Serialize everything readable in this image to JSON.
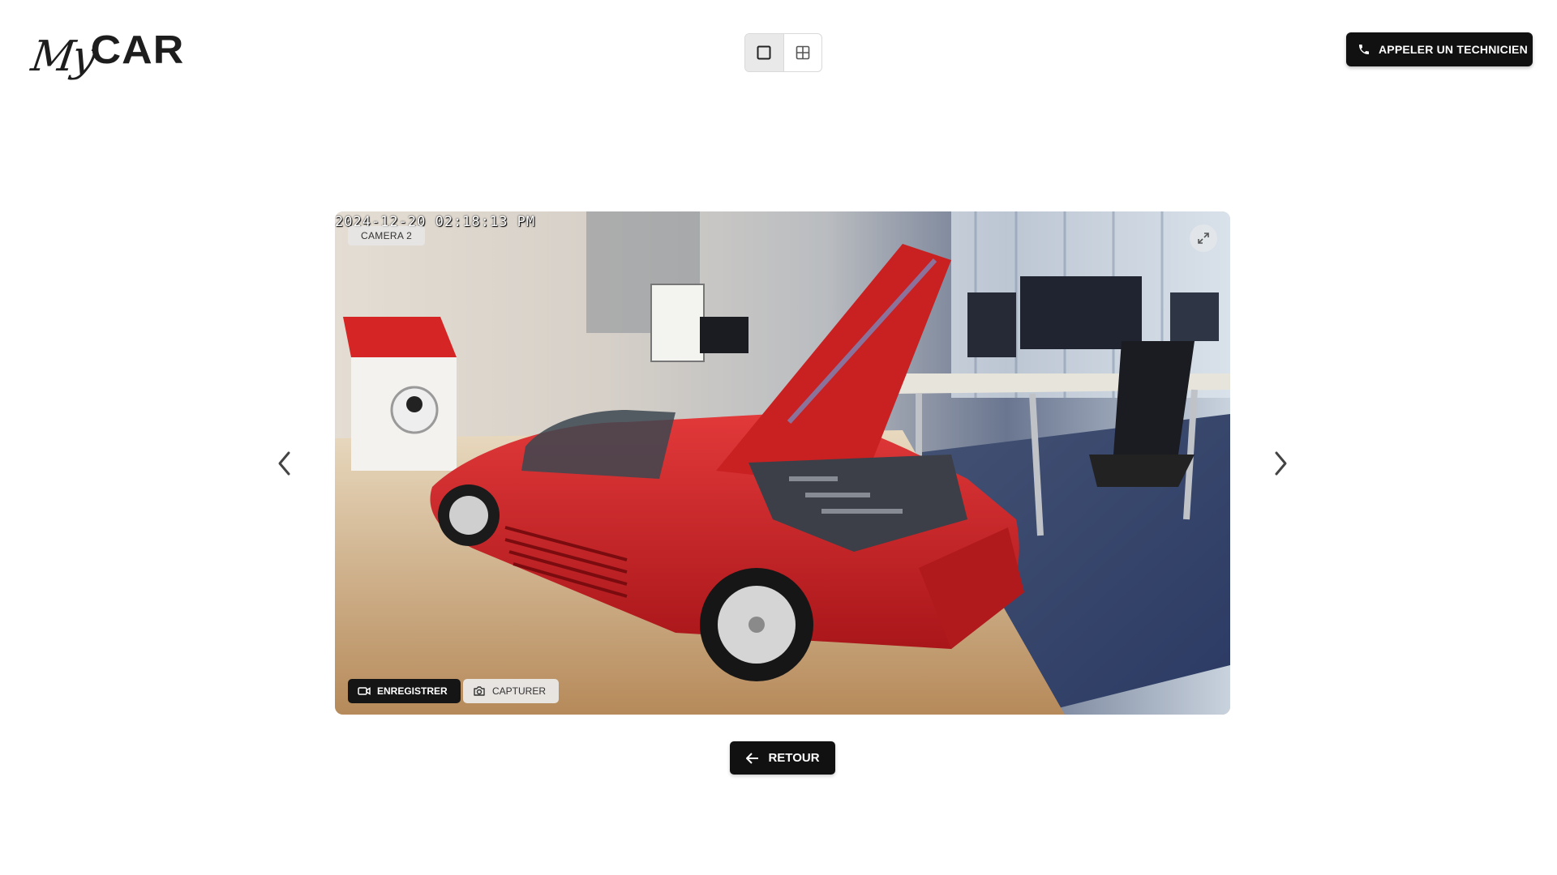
{
  "header": {
    "logo": {
      "script_part": "My",
      "bold_part": "CAR"
    },
    "view_toggle": {
      "options": [
        {
          "icon": "single-view-icon",
          "active": true
        },
        {
          "icon": "grid-view-icon",
          "active": false
        }
      ]
    },
    "call_button": {
      "label": "APPELER UN TECHNICIEN",
      "icon": "phone-icon"
    }
  },
  "viewer": {
    "timestamp": "2024-12-20 02:18:13 PM",
    "camera_label": "CAMERA 2",
    "fullscreen_icon": "expand-icon",
    "record_button": {
      "label": "ENREGISTRER",
      "icon": "video-camera-icon"
    },
    "capture_button": {
      "label": "CAPTURER",
      "icon": "camera-icon"
    },
    "prev_icon": "chevron-left-icon",
    "next_icon": "chevron-right-icon"
  },
  "back_button": {
    "label": "RETOUR",
    "icon": "arrow-left-icon"
  },
  "colors": {
    "primary_dark": "#111111",
    "background": "#ffffff",
    "toggle_active": "#e9e9e9",
    "car_red": "#c8201e"
  }
}
